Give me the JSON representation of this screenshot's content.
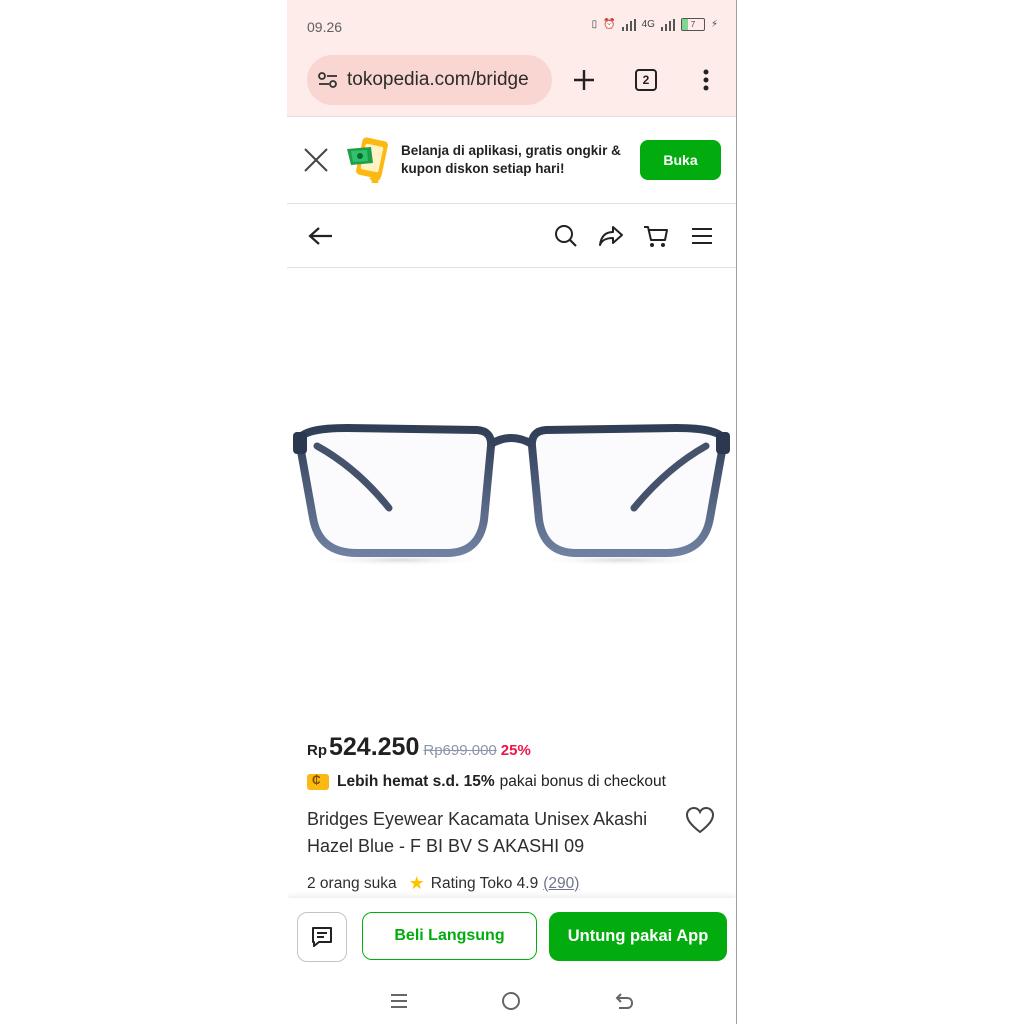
{
  "status_bar": {
    "time": "09.26",
    "battery": "7",
    "network": "4G"
  },
  "browser": {
    "url": "tokopedia.com/bridge",
    "tab_count": "2"
  },
  "app_banner": {
    "line1": "Belanja di aplikasi, gratis ongkir &",
    "line2": "kupon diskon setiap hari!",
    "open_button": "Buka"
  },
  "product": {
    "currency": "Rp",
    "price": "524.250",
    "original_price": "Rp699.000",
    "discount": "25%",
    "promo_bold": "Lebih hemat s.d. 15%",
    "promo_rest": "pakai bonus di checkout",
    "title": "Bridges Eyewear Kacamata Unisex Akashi Hazel Blue - F BI BV S AKASHI 09",
    "likes": "2 orang suka",
    "rating_label": "Rating Toko 4.9",
    "rating_count": "(290)"
  },
  "actions": {
    "buy_now": "Beli Langsung",
    "app_button": "Untung pakai App"
  },
  "colors": {
    "brand_green": "#03ac0e",
    "discount_red": "#ef144a",
    "frame_blue": "#5a6a85"
  }
}
